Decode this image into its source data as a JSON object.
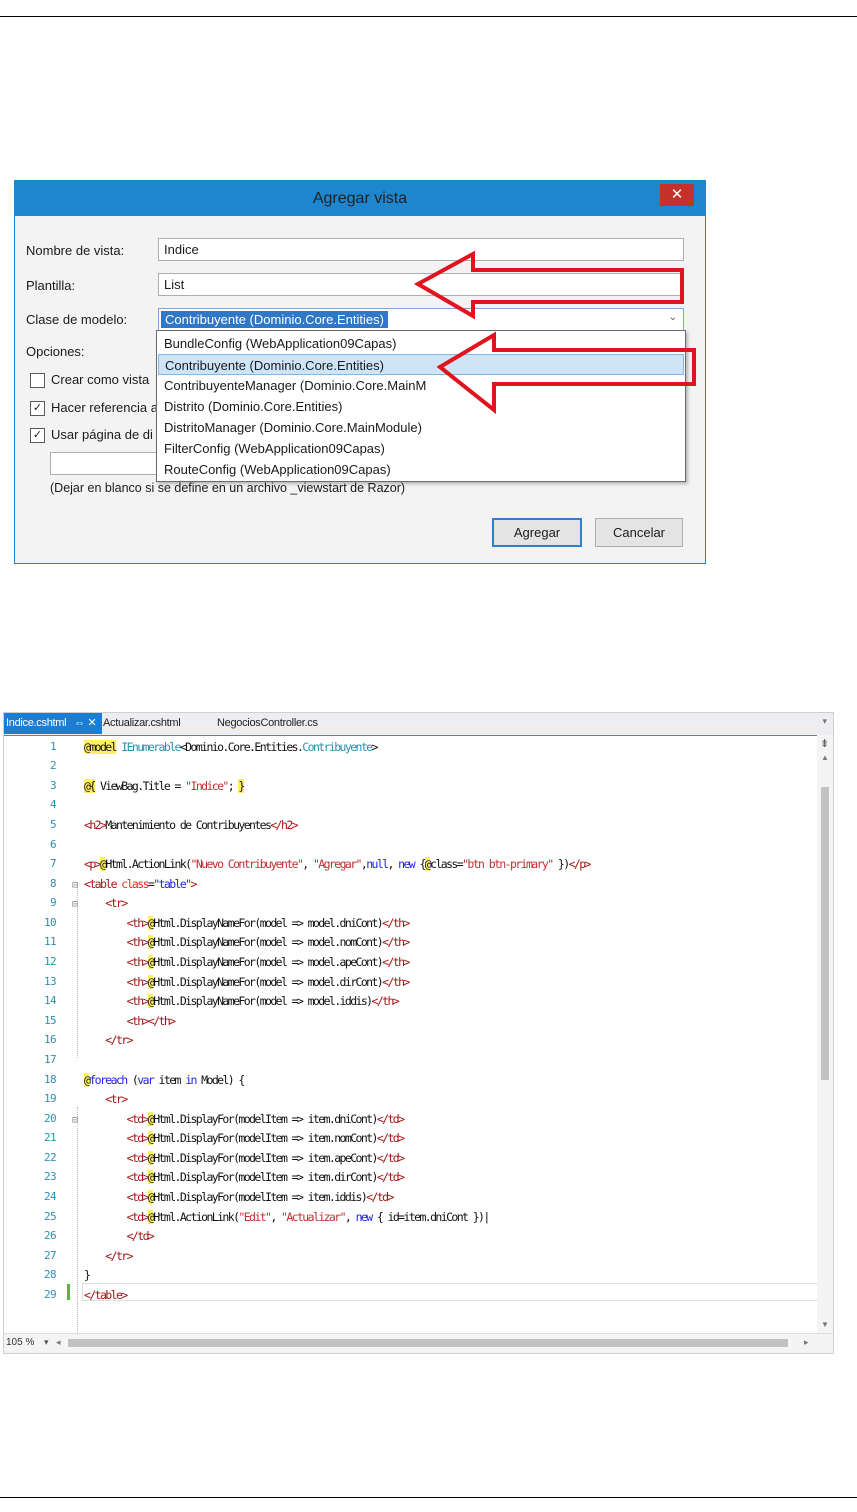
{
  "dialog": {
    "title": "Agregar vista",
    "close_glyph": "✕",
    "labels": {
      "view_name": "Nombre de vista:",
      "template": "Plantilla:",
      "model_class": "Clase de modelo:",
      "options": "Opciones:"
    },
    "view_name_value": "Indice",
    "template_value": "List",
    "model_class_value": "Contribuyente (Dominio.Core.Entities)",
    "dropdown_options": [
      "BundleConfig (WebApplication09Capas)",
      "Contribuyente (Dominio.Core.Entities)",
      "ContribuyenteManager (Dominio.Core.MainM",
      "Distrito (Dominio.Core.Entities)",
      "DistritoManager (Dominio.Core.MainModule)",
      "FilterConfig (WebApplication09Capas)",
      "RouteConfig (WebApplication09Capas)"
    ],
    "options": [
      {
        "label": "Crear como vista",
        "checked": false
      },
      {
        "label": "Hacer referencia a",
        "checked": true
      },
      {
        "label": "Usar página de di",
        "checked": true
      }
    ],
    "layout_hint": "(Dejar en blanco si se define en un archivo _viewstart de Razor)",
    "add_button": "Agregar",
    "cancel_button": "Cancelar"
  },
  "editor": {
    "tabs": [
      "Indice.cshtml",
      "Actualizar.cshtml",
      "NegociosController.cs"
    ],
    "active_tab_icons": "⇔ ✕",
    "zoom": "105 %",
    "line_numbers": [
      "1",
      "2",
      "3",
      "4",
      "5",
      "6",
      "7",
      "8",
      "9",
      "10",
      "11",
      "12",
      "13",
      "14",
      "15",
      "16",
      "17",
      "18",
      "19",
      "20",
      "21",
      "22",
      "23",
      "24",
      "25",
      "26",
      "27",
      "28",
      "29"
    ]
  },
  "colors": {
    "accent": "#1e85cf",
    "arrow_red": "#e0141e",
    "close_red": "#c7302b",
    "selection": "#2f78c8"
  }
}
